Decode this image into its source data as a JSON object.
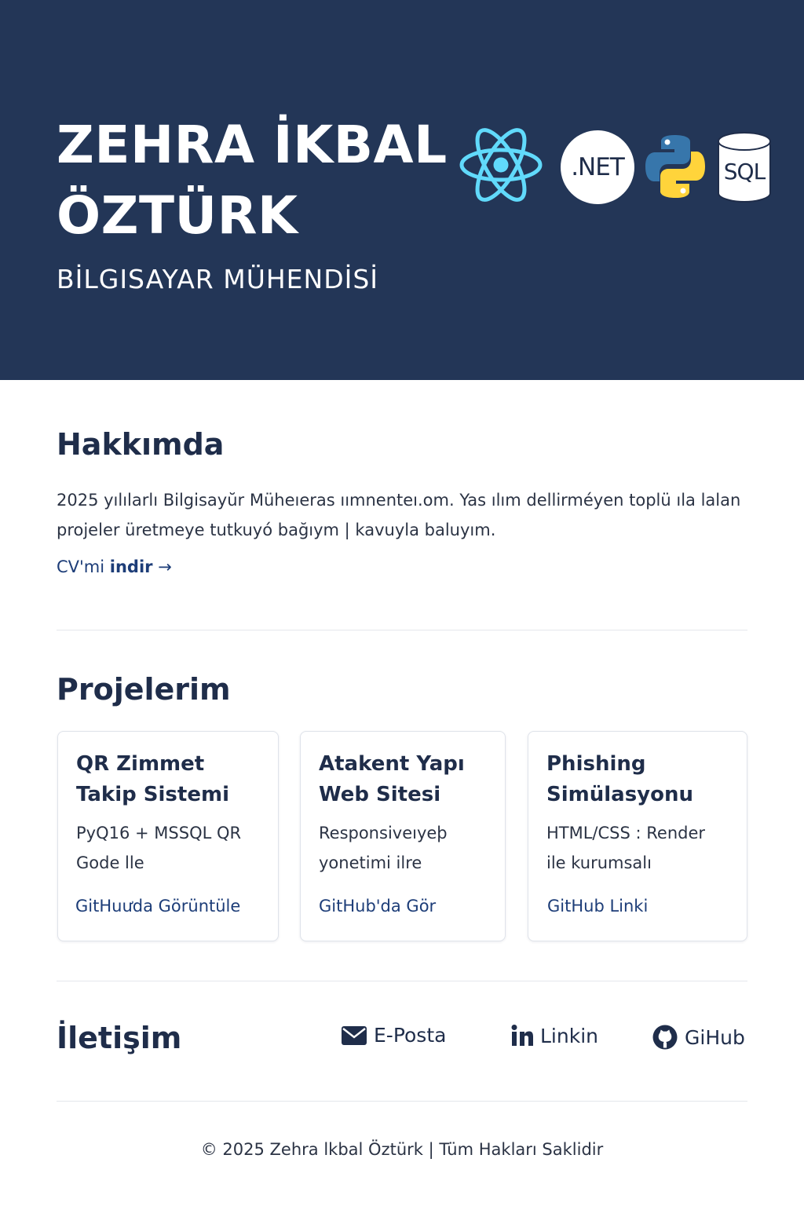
{
  "header": {
    "name_line1": "ZEHRA İKBAL",
    "name_line2": "ÖZTÜRK",
    "role": "BİLGISAYAR MÜHENDİSİ",
    "tech_icons": [
      "react-icon",
      "dotnet-icon",
      "python-icon",
      "sql-database-icon"
    ],
    "dotnet_label": ".NET",
    "sql_label": "SQL"
  },
  "about": {
    "heading": "Hakkımda",
    "text": "2025 yılılarlı Bilgisayŭr Müheıeras ıımnenteı.om. Yas ılım dellirméyen toplü ıla lalan projeler üretmeye tutkuyó bağıym | kavuyla baluyım.",
    "cv_link_prefix": "CV'mi ",
    "cv_link_bold": "indir",
    "cv_link_arrow": "→"
  },
  "projects": {
    "heading": "Projelerim",
    "items": [
      {
        "title": "QR Zimmet Takip Sistemi",
        "desc": "PyQ16 + MSSQL QR\nGode lle",
        "link": "GitHuưda Görüntüle"
      },
      {
        "title": "Atakent Yapı Web Sitesi",
        "desc": "Responsiveıyeþ\nyonetimi            ilre",
        "link": "GitHub'da Gör"
      },
      {
        "title": "Phishing Simülasyonu",
        "desc": "HTML/CSS : Render\nile kurumsalı",
        "link": "GitHub Linki"
      }
    ]
  },
  "contact": {
    "heading": "İletişim",
    "email_label": "E-Posta",
    "linkedin_label": "Linkin",
    "github_label": "GiHub"
  },
  "footer": {
    "text": "© 2025 Zehra lkbal Öztürk  |  Tüm Hakları Saklidir"
  },
  "colors": {
    "header_bg": "#233657",
    "heading": "#1f2d4a",
    "link": "#1d3d78",
    "react": "#61dafb",
    "python_blue": "#3776ab",
    "python_yellow": "#ffd43b"
  }
}
